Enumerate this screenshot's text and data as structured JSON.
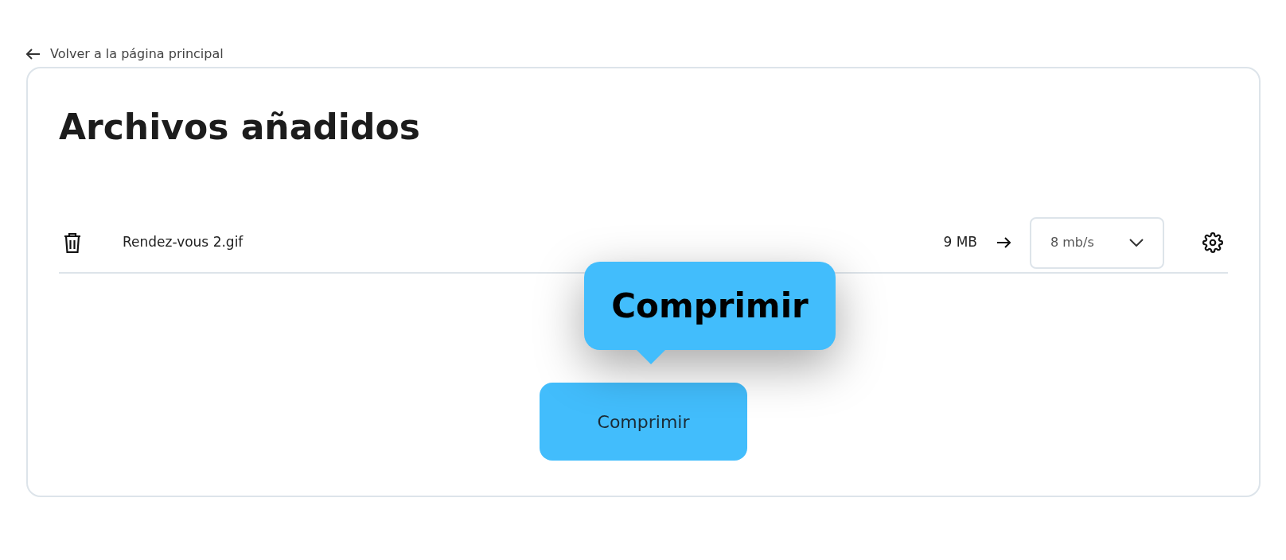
{
  "back_link": {
    "label": "Volver a la página principal"
  },
  "title": "Archivos añadidos",
  "files": [
    {
      "name": "Rendez-vous 2.gif",
      "size": "9 MB",
      "speed": "8 mb/s"
    }
  ],
  "tooltip": {
    "label": "Comprimir"
  },
  "compress_button": {
    "label": "Comprimir"
  }
}
